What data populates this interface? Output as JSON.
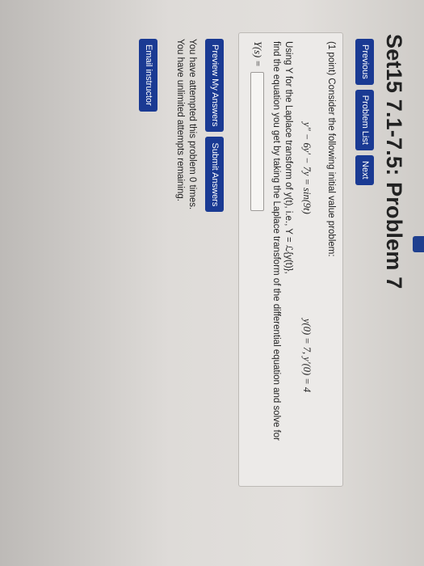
{
  "page": {
    "title": "Set15 7.1-7.5: Problem 7"
  },
  "nav": {
    "previous": "Previous",
    "problem_list": "Problem List",
    "next": "Next"
  },
  "problem": {
    "intro": "(1 point) Consider the following initial value problem:",
    "equation": "y″ − 6y′ − 7y = sin(9t)",
    "initial_conditions": "y(0) = 7,  y′(0) = 4",
    "instruction_line1": "Using Y for the Laplace transform of y(t), i.e., Y = ℒ{y(t)},",
    "instruction_line2": "find the equation you get by taking the Laplace transform of the differential equation and solve for",
    "answer_label": "Y(s) =",
    "answer_value": ""
  },
  "actions": {
    "preview": "Preview My Answers",
    "submit": "Submit Answers"
  },
  "status": {
    "attempted": "You have attempted this problem 0 times.",
    "remaining": "You have unlimited attempts remaining."
  },
  "footer": {
    "email": "Email instructor"
  },
  "colors": {
    "button": "#1a3a93",
    "box_bg": "#eceae8"
  }
}
